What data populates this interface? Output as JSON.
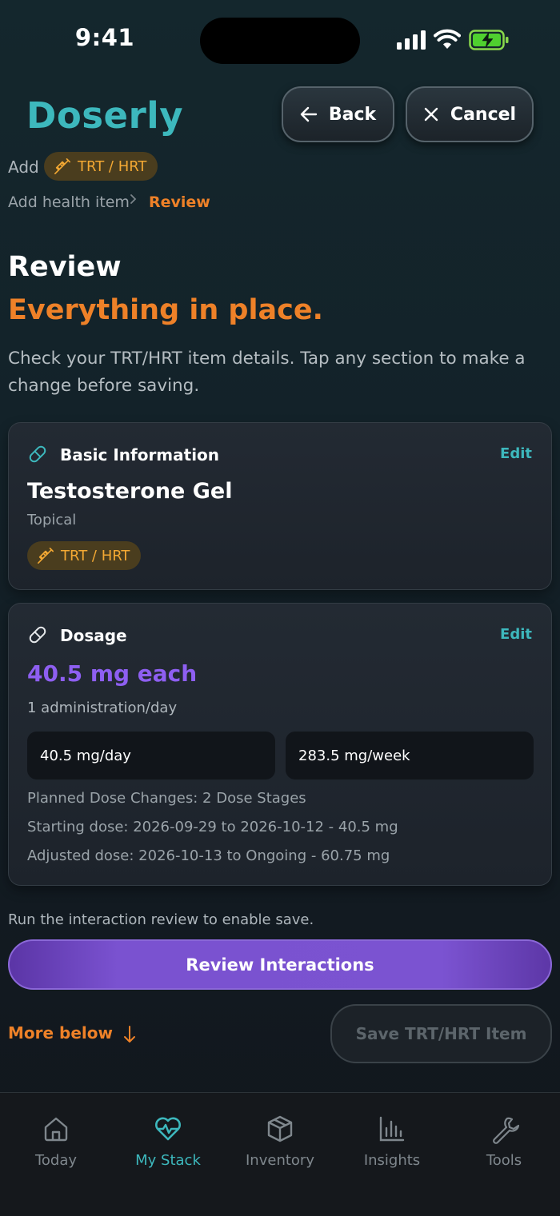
{
  "status_bar": {
    "time": "9:41"
  },
  "app": {
    "logo": "Doserly"
  },
  "header": {
    "back_label": "Back",
    "cancel_label": "Cancel"
  },
  "context": {
    "add_label": "Add",
    "category_chip": "TRT / HRT"
  },
  "breadcrumb": {
    "items": [
      "Add health item",
      "Review"
    ],
    "separator": ">"
  },
  "page": {
    "title": "Review",
    "subtitle": "Everything in place.",
    "description": "Check your TRT/HRT item details. Tap any section to make a change before saving."
  },
  "basic_info": {
    "section_title": "Basic Information",
    "edit_label": "Edit",
    "name": "Testosterone Gel",
    "route": "Topical",
    "category": "TRT / HRT"
  },
  "dosage": {
    "section_title": "Dosage",
    "edit_label": "Edit",
    "amount": "40.5 mg each",
    "frequency": "1 administration/day",
    "daily_total": "40.5 mg/day",
    "weekly_total": "283.5 mg/week",
    "plan_lines": [
      "Planned Dose Changes: 2 Dose Stages",
      "Starting dose: 2026-09-29 to 2026-10-12 - 40.5 mg",
      "Adjusted dose: 2026-10-13 to Ongoing - 60.75 mg"
    ]
  },
  "actions": {
    "hint": "Run the interaction review to enable save.",
    "review_label": "Review Interactions",
    "more_below_label": "More below",
    "save_label": "Save TRT/HRT Item"
  },
  "tabbar": {
    "items": [
      {
        "label": "Today",
        "icon": "home-icon",
        "active": false
      },
      {
        "label": "My Stack",
        "icon": "heart-pulse-icon",
        "active": true
      },
      {
        "label": "Inventory",
        "icon": "box-icon",
        "active": false
      },
      {
        "label": "Insights",
        "icon": "bar-chart-icon",
        "active": false
      },
      {
        "label": "Tools",
        "icon": "wrench-icon",
        "active": false
      }
    ]
  },
  "colors": {
    "accent_teal": "#3db8bd",
    "accent_orange": "#ee8128",
    "accent_purple": "#8e5ff1",
    "chip_text": "#f3a833"
  }
}
